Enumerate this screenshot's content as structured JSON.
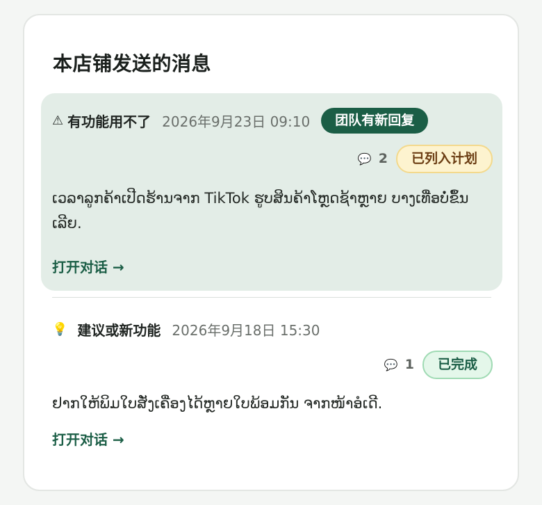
{
  "panel": {
    "title": "本店铺发送的消息"
  },
  "messages": [
    {
      "type_icon": "warning-icon",
      "type_glyph": "⚠",
      "type_label": "有功能用不了",
      "timestamp": "2026年9月23日 09:10",
      "team_badge": "团队有新回复",
      "comment_count": "2",
      "status_badge": "已列入计划",
      "body": "ເວລາລູກຄ້າເປີດຮ້ານຈາກ TikTok ຮູບສິນຄ້າໂຫຼດຊ້າຫຼາຍ ບາງເທື່ອບໍ່ຂຶ້ນເລີຍ.",
      "link": "打开对话 →",
      "colors": {
        "background": "#e3ede7",
        "team_badge": "#1b5e46",
        "status_badge": "#fdf3cf"
      }
    },
    {
      "type_icon": "lightbulb-icon",
      "type_glyph": "💡",
      "type_label": "建议或新功能",
      "timestamp": "2026年9月18日 15:30",
      "comment_count": "1",
      "status_badge": "已完成",
      "body": "ຢາກໃຫ້ພິມໃບສັ່ງເຄື່ອງໄດ້ຫຼາຍໃບພ້ອມກັນ ຈາກໜ້າອໍເດີ.",
      "link": "打开对话 →",
      "colors": {
        "background": "#ffffff",
        "status_badge": "#e4f7ea"
      }
    }
  ],
  "icons": {
    "comment_glyph": "💬"
  }
}
